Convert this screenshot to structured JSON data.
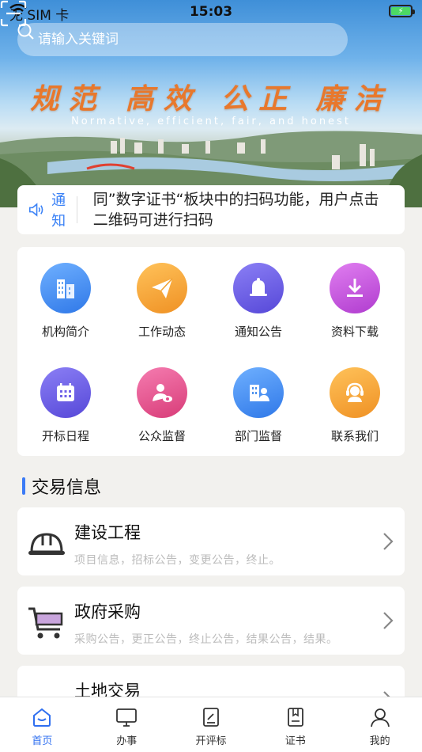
{
  "status_bar": {
    "carrier": "无 SIM 卡",
    "time": "15:03",
    "battery_icon": "battery-charging-icon"
  },
  "search": {
    "placeholder": "请输入关键词",
    "scan_icon": "scan-icon"
  },
  "banner": {
    "slogan_cn": "规范 高效 公正 廉洁",
    "slogan_en": "Normative, efficient, fair, and honest"
  },
  "notice": {
    "label": "通知",
    "text": "同”数字证书“板块中的扫码功能，用户点击二维码可进行扫码"
  },
  "grid": {
    "items": [
      {
        "label": "机构简介",
        "icon": "building-icon",
        "color": "#3d8cf2"
      },
      {
        "label": "工作动态",
        "icon": "paper-plane-icon",
        "color": "#f0a030"
      },
      {
        "label": "通知公告",
        "icon": "bell-icon",
        "color": "#6a5ee8"
      },
      {
        "label": "资料下载",
        "icon": "download-icon",
        "color": "#c04bd8"
      },
      {
        "label": "开标日程",
        "icon": "calendar-icon",
        "color": "#6a5ee8"
      },
      {
        "label": "公众监督",
        "icon": "person-eye-icon",
        "color": "#e6508f"
      },
      {
        "label": "部门监督",
        "icon": "department-icon",
        "color": "#3d8cf2"
      },
      {
        "label": "联系我们",
        "icon": "headset-icon",
        "color": "#f0a030"
      }
    ]
  },
  "section": {
    "title": "交易信息"
  },
  "trades": [
    {
      "title": "建设工程",
      "subtitle": "项目信息，招标公告，变更公告，终止。",
      "icon": "hard-hat-icon"
    },
    {
      "title": "政府采购",
      "subtitle": "采购公告，更正公告，终止公告，结果公告，结果。",
      "icon": "cart-icon"
    },
    {
      "title": "土地交易",
      "subtitle": "",
      "icon": "land-icon"
    }
  ],
  "tabs": [
    {
      "label": "首页",
      "icon": "home-icon",
      "active": true
    },
    {
      "label": "办事",
      "icon": "monitor-icon",
      "active": false
    },
    {
      "label": "开评标",
      "icon": "document-edit-icon",
      "active": false
    },
    {
      "label": "证书",
      "icon": "book-icon",
      "active": false
    },
    {
      "label": "我的",
      "icon": "user-icon",
      "active": false
    }
  ],
  "colors": {
    "accent": "#2f6ff0",
    "slogan": "#e8782c"
  }
}
